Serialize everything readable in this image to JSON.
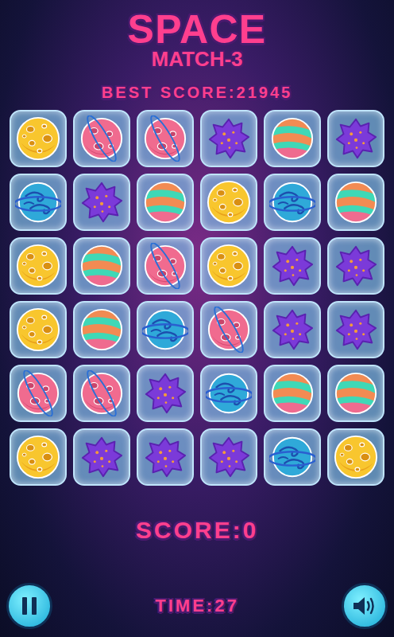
{
  "title": "SPACE",
  "subtitle": "MATCH-3",
  "best_score": "BEST SCORE:21945",
  "board": {
    "rows": [
      [
        "moon",
        "ringed",
        "ringed",
        "blob",
        "striped",
        "blob"
      ],
      [
        "swirl",
        "blob",
        "striped",
        "moon",
        "swirl",
        "striped"
      ],
      [
        "moon",
        "striped",
        "ringed",
        "moon",
        "blob",
        "blob"
      ],
      [
        "moon",
        "striped",
        "swirl",
        "ringed",
        "blob",
        "blob"
      ],
      [
        "ringed",
        "ringed",
        "blob",
        "swirl",
        "striped",
        "striped"
      ],
      [
        "moon",
        "blob",
        "blob",
        "blob",
        "swirl",
        "moon"
      ]
    ]
  },
  "score": "SCORE:0",
  "time": "TIME:27",
  "sound_on": true
}
